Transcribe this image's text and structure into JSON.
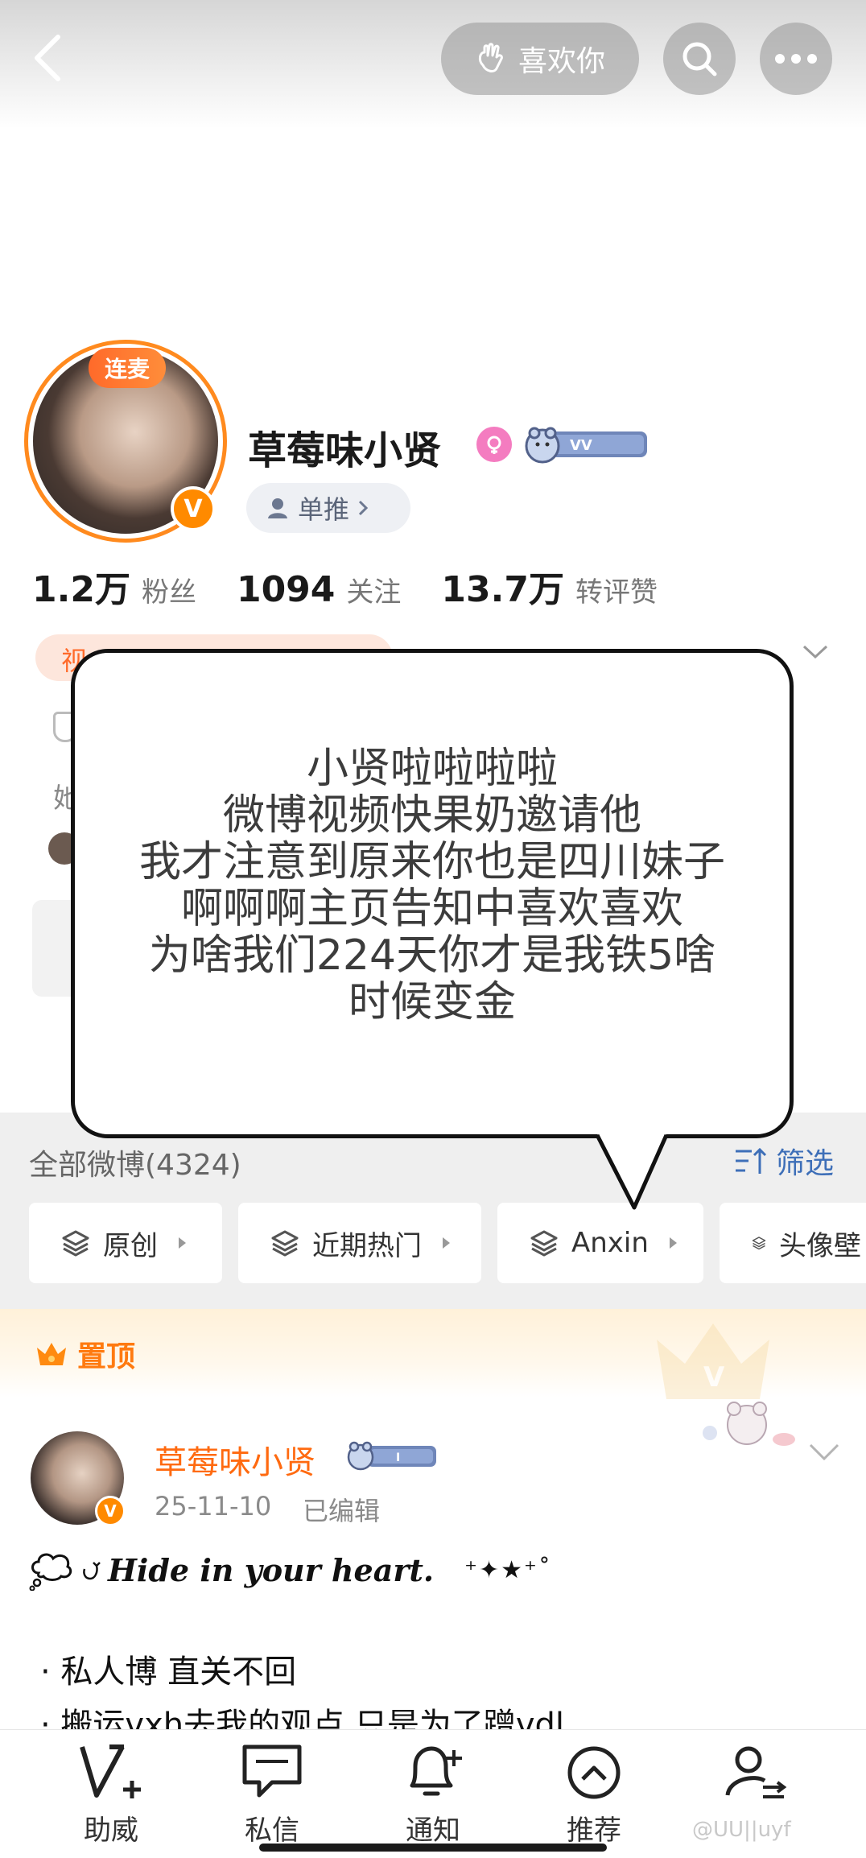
{
  "header": {
    "like_label": "喜欢你"
  },
  "profile": {
    "live_badge": "连麦",
    "verified_mark": "V",
    "name": "草莓味小贤",
    "fan_chip_label": "单推",
    "stats": [
      {
        "value": "1.2万",
        "label": "粉丝"
      },
      {
        "value": "1094",
        "label": "关注"
      },
      {
        "value": "13.7万",
        "label": "转评赞"
      }
    ],
    "hidden_chip_text": "视",
    "hidden_line_text": "她"
  },
  "bubble": {
    "lines": [
      "小贤啦啦啦啦",
      "微博视频快果奶邀请他",
      "我才注意到原来你也是四川妹子",
      "啊啊啊主页告知中喜欢喜欢",
      "为啥我们224天你才是我铁5啥",
      "时候变金"
    ]
  },
  "posts_bar": {
    "all_label": "全部微博(4324)",
    "filter_label": "筛选",
    "pills": [
      "原创",
      "近期热门",
      "Anxin",
      "头像壁"
    ]
  },
  "pinned": {
    "label": "置顶",
    "author": "草莓味小贤",
    "date": "25-11-10",
    "edited": "已编辑",
    "line1_text": "Hide in your heart.",
    "line1_stars": "⁺✦★⁺˚",
    "line2": "·  私人博  直关不回",
    "line3": "·  搬运vxh去我的观点 只是为了蹭vdl"
  },
  "tabbar": {
    "items": [
      "助威",
      "私信",
      "通知",
      "推荐"
    ]
  },
  "watermark": "@UU||uyf",
  "colors": {
    "accent_orange": "#ff8a1e",
    "link_blue": "#3e6fb8"
  }
}
